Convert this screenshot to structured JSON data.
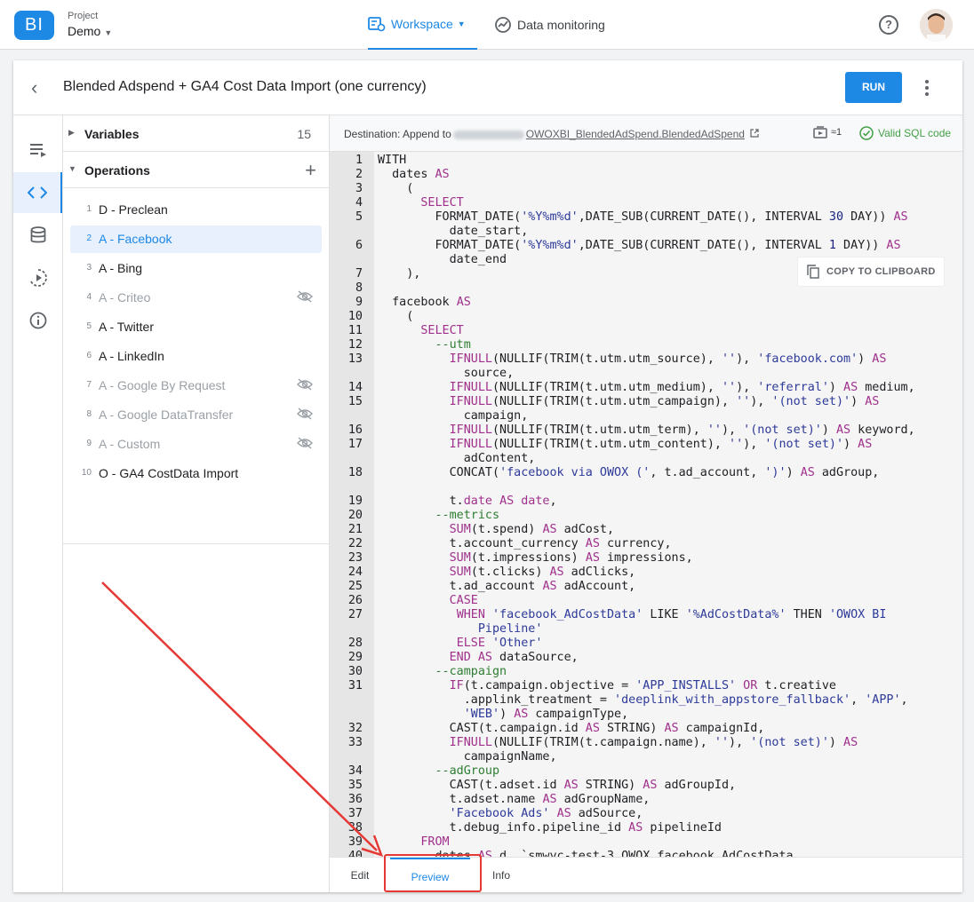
{
  "topbar": {
    "logo_text": "BI",
    "project_caption": "Project",
    "project_name": "Demo",
    "nav": [
      {
        "label": "Workspace",
        "icon": "workspace-icon",
        "active": true
      },
      {
        "label": "Data monitoring",
        "icon": "monitoring-icon",
        "active": false
      }
    ],
    "help_glyph": "?"
  },
  "header": {
    "title": "Blended Adspend + GA4 Cost Data Import (one currency)",
    "run_label": "RUN"
  },
  "panel": {
    "variables_label": "Variables",
    "variables_count": "15",
    "operations_label": "Operations",
    "operations": [
      {
        "num": "1",
        "name": "D - Preclean",
        "disabled": false,
        "hidden_icon": false
      },
      {
        "num": "2",
        "name": "A - Facebook",
        "selected": true,
        "disabled": false,
        "hidden_icon": false
      },
      {
        "num": "3",
        "name": "A - Bing",
        "disabled": false,
        "hidden_icon": false
      },
      {
        "num": "4",
        "name": "A - Criteo",
        "disabled": true,
        "hidden_icon": true
      },
      {
        "num": "5",
        "name": "A - Twitter",
        "disabled": false,
        "hidden_icon": false
      },
      {
        "num": "6",
        "name": "A - LinkedIn",
        "disabled": false,
        "hidden_icon": false
      },
      {
        "num": "7",
        "name": "A - Google By Request",
        "disabled": true,
        "hidden_icon": true
      },
      {
        "num": "8",
        "name": "A - Google DataTransfer",
        "disabled": true,
        "hidden_icon": true
      },
      {
        "num": "9",
        "name": "A - Custom",
        "disabled": true,
        "hidden_icon": true
      },
      {
        "num": "10",
        "name": "O - GA4 CostData Import",
        "disabled": false,
        "hidden_icon": false
      }
    ]
  },
  "editor": {
    "destination_prefix": "Destination: Append to",
    "destination_table": "OWOXBI_BlendedAdSpend.BlendedAdSpend",
    "bytes": "≈1",
    "valid_label": "Valid SQL code",
    "copy_label": "COPY TO CLIPBOARD",
    "bottom_tabs": [
      {
        "label": "Edit",
        "active": false
      },
      {
        "label": "Preview",
        "active": true
      },
      {
        "label": "Info",
        "active": false
      }
    ],
    "code": [
      {
        "n": "1",
        "t": [
          [
            "WITH",
            ""
          ]
        ]
      },
      {
        "n": "2",
        "t": [
          [
            "  dates ",
            ""
          ],
          [
            "AS",
            "kw"
          ]
        ]
      },
      {
        "n": "3",
        "t": [
          [
            "    (",
            ""
          ]
        ]
      },
      {
        "n": "4",
        "t": [
          [
            "      ",
            ""
          ],
          [
            "SELECT",
            "kw"
          ]
        ]
      },
      {
        "n": "5",
        "t": [
          [
            "        FORMAT_DATE(",
            ""
          ],
          [
            "'%Y%m%d'",
            "str"
          ],
          [
            ",DATE_SUB(CURRENT_DATE(), INTERVAL ",
            ""
          ],
          [
            "30",
            "num"
          ],
          [
            " DAY)) ",
            ""
          ],
          [
            "AS",
            "kw"
          ]
        ]
      },
      {
        "n": "",
        "t": [
          [
            "          date_start,",
            ""
          ]
        ]
      },
      {
        "n": "6",
        "t": [
          [
            "        FORMAT_DATE(",
            ""
          ],
          [
            "'%Y%m%d'",
            "str"
          ],
          [
            ",DATE_SUB(CURRENT_DATE(), INTERVAL ",
            ""
          ],
          [
            "1",
            "num"
          ],
          [
            " DAY)) ",
            ""
          ],
          [
            "AS",
            "kw"
          ]
        ]
      },
      {
        "n": "",
        "t": [
          [
            "          date_end",
            ""
          ]
        ]
      },
      {
        "n": "7",
        "t": [
          [
            "    ),",
            ""
          ]
        ]
      },
      {
        "n": "8",
        "t": [
          [
            "",
            ""
          ]
        ]
      },
      {
        "n": "9",
        "t": [
          [
            "  facebook ",
            ""
          ],
          [
            "AS",
            "kw"
          ]
        ]
      },
      {
        "n": "10",
        "t": [
          [
            "    (",
            ""
          ]
        ]
      },
      {
        "n": "11",
        "t": [
          [
            "      ",
            ""
          ],
          [
            "SELECT",
            "kw"
          ]
        ]
      },
      {
        "n": "12",
        "t": [
          [
            "        ",
            ""
          ],
          [
            "--utm",
            "cm"
          ]
        ]
      },
      {
        "n": "13",
        "t": [
          [
            "          ",
            ""
          ],
          [
            "IFNULL",
            "kw"
          ],
          [
            "(NULLIF(TRIM(t.utm.utm_source), ",
            ""
          ],
          [
            "''",
            "str"
          ],
          [
            "), ",
            ""
          ],
          [
            "'facebook.com'",
            "str"
          ],
          [
            ") ",
            ""
          ],
          [
            "AS",
            "kw"
          ]
        ]
      },
      {
        "n": "",
        "t": [
          [
            "            source,",
            ""
          ]
        ]
      },
      {
        "n": "14",
        "t": [
          [
            "          ",
            ""
          ],
          [
            "IFNULL",
            "kw"
          ],
          [
            "(NULLIF(TRIM(t.utm.utm_medium), ",
            ""
          ],
          [
            "''",
            "str"
          ],
          [
            "), ",
            ""
          ],
          [
            "'referral'",
            "str"
          ],
          [
            ") ",
            ""
          ],
          [
            "AS",
            "kw"
          ],
          [
            " medium,",
            ""
          ]
        ]
      },
      {
        "n": "15",
        "t": [
          [
            "          ",
            ""
          ],
          [
            "IFNULL",
            "kw"
          ],
          [
            "(NULLIF(TRIM(t.utm.utm_campaign), ",
            ""
          ],
          [
            "''",
            "str"
          ],
          [
            "), ",
            ""
          ],
          [
            "'(not set)'",
            "str"
          ],
          [
            ") ",
            ""
          ],
          [
            "AS",
            "kw"
          ]
        ]
      },
      {
        "n": "",
        "t": [
          [
            "            campaign,",
            ""
          ]
        ]
      },
      {
        "n": "16",
        "t": [
          [
            "          ",
            ""
          ],
          [
            "IFNULL",
            "kw"
          ],
          [
            "(NULLIF(TRIM(t.utm.utm_term), ",
            ""
          ],
          [
            "''",
            "str"
          ],
          [
            "), ",
            ""
          ],
          [
            "'(not set)'",
            "str"
          ],
          [
            ") ",
            ""
          ],
          [
            "AS",
            "kw"
          ],
          [
            " keyword,",
            ""
          ]
        ]
      },
      {
        "n": "17",
        "t": [
          [
            "          ",
            ""
          ],
          [
            "IFNULL",
            "kw"
          ],
          [
            "(NULLIF(TRIM(t.utm.utm_content), ",
            ""
          ],
          [
            "''",
            "str"
          ],
          [
            "), ",
            ""
          ],
          [
            "'(not set)'",
            "str"
          ],
          [
            ") ",
            ""
          ],
          [
            "AS",
            "kw"
          ]
        ]
      },
      {
        "n": "",
        "t": [
          [
            "            adContent,",
            ""
          ]
        ]
      },
      {
        "n": "18",
        "t": [
          [
            "          CONCAT(",
            ""
          ],
          [
            "'facebook via OWOX ('",
            "str"
          ],
          [
            ", t.ad_account, ",
            ""
          ],
          [
            "')'",
            "str"
          ],
          [
            ") ",
            ""
          ],
          [
            "AS",
            "kw"
          ],
          [
            " adGroup,",
            ""
          ]
        ]
      },
      {
        "n": "",
        "t": [
          [
            "",
            ""
          ]
        ]
      },
      {
        "n": "19",
        "t": [
          [
            "          t.",
            ""
          ],
          [
            "date",
            "kw"
          ],
          [
            " ",
            ""
          ],
          [
            "AS",
            "kw"
          ],
          [
            " ",
            ""
          ],
          [
            "date",
            "kw"
          ],
          [
            ",",
            ""
          ]
        ]
      },
      {
        "n": "20",
        "t": [
          [
            "        ",
            ""
          ],
          [
            "--metrics",
            "cm"
          ]
        ]
      },
      {
        "n": "21",
        "t": [
          [
            "          ",
            ""
          ],
          [
            "SUM",
            "kw"
          ],
          [
            "(t.spend) ",
            ""
          ],
          [
            "AS",
            "kw"
          ],
          [
            " adCost,",
            ""
          ]
        ]
      },
      {
        "n": "22",
        "t": [
          [
            "          t.account_currency ",
            ""
          ],
          [
            "AS",
            "kw"
          ],
          [
            " currency,",
            ""
          ]
        ]
      },
      {
        "n": "23",
        "t": [
          [
            "          ",
            ""
          ],
          [
            "SUM",
            "kw"
          ],
          [
            "(t.impressions) ",
            ""
          ],
          [
            "AS",
            "kw"
          ],
          [
            " impressions,",
            ""
          ]
        ]
      },
      {
        "n": "24",
        "t": [
          [
            "          ",
            ""
          ],
          [
            "SUM",
            "kw"
          ],
          [
            "(t.clicks) ",
            ""
          ],
          [
            "AS",
            "kw"
          ],
          [
            " adClicks,",
            ""
          ]
        ]
      },
      {
        "n": "25",
        "t": [
          [
            "          t.ad_account ",
            ""
          ],
          [
            "AS",
            "kw"
          ],
          [
            " adAccount,",
            ""
          ]
        ]
      },
      {
        "n": "26",
        "t": [
          [
            "          ",
            ""
          ],
          [
            "CASE",
            "kw"
          ]
        ]
      },
      {
        "n": "27",
        "t": [
          [
            "           ",
            ""
          ],
          [
            "WHEN",
            "kw"
          ],
          [
            " ",
            ""
          ],
          [
            "'facebook_AdCostData'",
            "str"
          ],
          [
            " LIKE ",
            ""
          ],
          [
            "'%AdCostData%'",
            "str"
          ],
          [
            " THEN ",
            ""
          ],
          [
            "'OWOX BI",
            "str"
          ]
        ]
      },
      {
        "n": "",
        "t": [
          [
            "              ",
            ""
          ],
          [
            "Pipeline'",
            "str"
          ]
        ]
      },
      {
        "n": "28",
        "t": [
          [
            "           ",
            ""
          ],
          [
            "ELSE",
            "kw"
          ],
          [
            " ",
            ""
          ],
          [
            "'Other'",
            "str"
          ]
        ]
      },
      {
        "n": "29",
        "t": [
          [
            "          ",
            ""
          ],
          [
            "END",
            "kw"
          ],
          [
            " ",
            ""
          ],
          [
            "AS",
            "kw"
          ],
          [
            " dataSource,",
            ""
          ]
        ]
      },
      {
        "n": "30",
        "t": [
          [
            "        ",
            ""
          ],
          [
            "--campaign",
            "cm"
          ]
        ]
      },
      {
        "n": "31",
        "t": [
          [
            "          ",
            ""
          ],
          [
            "IF",
            "kw"
          ],
          [
            "(t.campaign.objective = ",
            ""
          ],
          [
            "'APP_INSTALLS'",
            "str"
          ],
          [
            " ",
            ""
          ],
          [
            "OR",
            "kw"
          ],
          [
            " t.creative",
            ""
          ]
        ]
      },
      {
        "n": "",
        "t": [
          [
            "            .applink_treatment = ",
            ""
          ],
          [
            "'deeplink_with_appstore_fallback'",
            "str"
          ],
          [
            ", ",
            ""
          ],
          [
            "'APP'",
            "str"
          ],
          [
            ",",
            ""
          ]
        ]
      },
      {
        "n": "",
        "t": [
          [
            "            ",
            ""
          ],
          [
            "'WEB'",
            "str"
          ],
          [
            ") ",
            ""
          ],
          [
            "AS",
            "kw"
          ],
          [
            " campaignType,",
            ""
          ]
        ]
      },
      {
        "n": "32",
        "t": [
          [
            "          CAST(t.campaign.id ",
            ""
          ],
          [
            "AS",
            "kw"
          ],
          [
            " STRING) ",
            ""
          ],
          [
            "AS",
            "kw"
          ],
          [
            " campaignId,",
            ""
          ]
        ]
      },
      {
        "n": "33",
        "t": [
          [
            "          ",
            ""
          ],
          [
            "IFNULL",
            "kw"
          ],
          [
            "(NULLIF(TRIM(t.campaign.name), ",
            ""
          ],
          [
            "''",
            "str"
          ],
          [
            "), ",
            ""
          ],
          [
            "'(not set)'",
            "str"
          ],
          [
            ") ",
            ""
          ],
          [
            "AS",
            "kw"
          ]
        ]
      },
      {
        "n": "",
        "t": [
          [
            "            campaignName,",
            ""
          ]
        ]
      },
      {
        "n": "34",
        "t": [
          [
            "        ",
            ""
          ],
          [
            "--adGroup",
            "cm"
          ]
        ]
      },
      {
        "n": "35",
        "t": [
          [
            "          CAST(t.adset.id ",
            ""
          ],
          [
            "AS",
            "kw"
          ],
          [
            " STRING) ",
            ""
          ],
          [
            "AS",
            "kw"
          ],
          [
            " adGroupId,",
            ""
          ]
        ]
      },
      {
        "n": "36",
        "t": [
          [
            "          t.adset.name ",
            ""
          ],
          [
            "AS",
            "kw"
          ],
          [
            " adGroupName,",
            ""
          ]
        ]
      },
      {
        "n": "37",
        "t": [
          [
            "          ",
            ""
          ],
          [
            "'Facebook Ads'",
            "str"
          ],
          [
            " ",
            ""
          ],
          [
            "AS",
            "kw"
          ],
          [
            " adSource,",
            ""
          ]
        ]
      },
      {
        "n": "38",
        "t": [
          [
            "          t.debug_info.pipeline_id ",
            ""
          ],
          [
            "AS",
            "kw"
          ],
          [
            " pipelineId",
            ""
          ]
        ]
      },
      {
        "n": "39",
        "t": [
          [
            "      ",
            ""
          ],
          [
            "FROM",
            "kw"
          ]
        ]
      },
      {
        "n": "40",
        "t": [
          [
            "        dates ",
            ""
          ],
          [
            "AS",
            "kw"
          ],
          [
            " d, `smwyc-test-3.OWOX_facebook.AdCostData",
            ""
          ]
        ]
      }
    ]
  },
  "colors": {
    "accent": "#1e88e5",
    "valid": "#43a047",
    "annotation": "#e53935",
    "keyword": "#a0308c",
    "string": "#2d3a9a",
    "comment": "#2e7d32"
  }
}
